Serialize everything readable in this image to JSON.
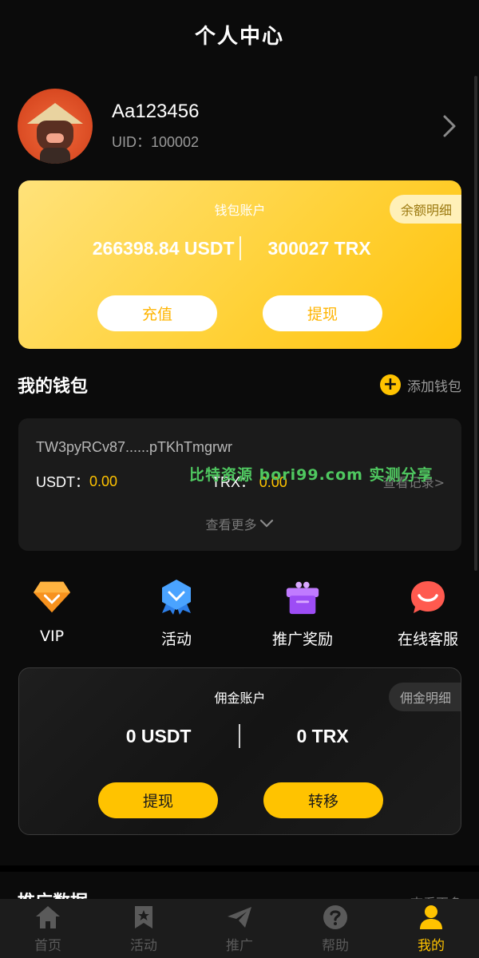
{
  "header": {
    "title": "个人中心"
  },
  "profile": {
    "username": "Aa123456",
    "uid": "UID：100002"
  },
  "wallet_account": {
    "title": "钱包账户",
    "detail_label": "余额明细",
    "usdt": "266398.84 USDT",
    "trx": "300027 TRX",
    "deposit_label": "充值",
    "withdraw_label": "提现"
  },
  "my_wallet": {
    "title": "我的钱包",
    "add_label": "添加钱包",
    "address": "TW3pyRCv87......pTKhTmgrwr",
    "usdt_label": "USDT：",
    "usdt_value": "0.00",
    "trx_label": "TRX：",
    "trx_value": "0.00",
    "records_label": "查看记录>",
    "more_label": "查看更多",
    "watermark": "比特资源 bori99.com 实测分享"
  },
  "quick_actions": [
    {
      "label": "VIP",
      "icon": "vip-diamond-icon"
    },
    {
      "label": "活动",
      "icon": "activity-badge-icon"
    },
    {
      "label": "推广奖励",
      "icon": "gift-icon"
    },
    {
      "label": "在线客服",
      "icon": "chat-bubble-icon"
    }
  ],
  "commission_account": {
    "title": "佣金账户",
    "detail_label": "佣金明细",
    "usdt": "0 USDT",
    "trx": "0 TRX",
    "withdraw_label": "提现",
    "transfer_label": "转移"
  },
  "partial_section": {
    "title": "推广数据",
    "right": "查看更多"
  },
  "tabbar": [
    {
      "label": "首页",
      "icon": "home-icon",
      "active": false
    },
    {
      "label": "活动",
      "icon": "star-bookmark-icon",
      "active": false
    },
    {
      "label": "推广",
      "icon": "paper-plane-icon",
      "active": false
    },
    {
      "label": "帮助",
      "icon": "help-icon",
      "active": false
    },
    {
      "label": "我的",
      "icon": "user-icon",
      "active": true
    }
  ],
  "colors": {
    "accent": "#ffc300",
    "background": "#0b0b0b",
    "card": "#1b1b1b"
  }
}
